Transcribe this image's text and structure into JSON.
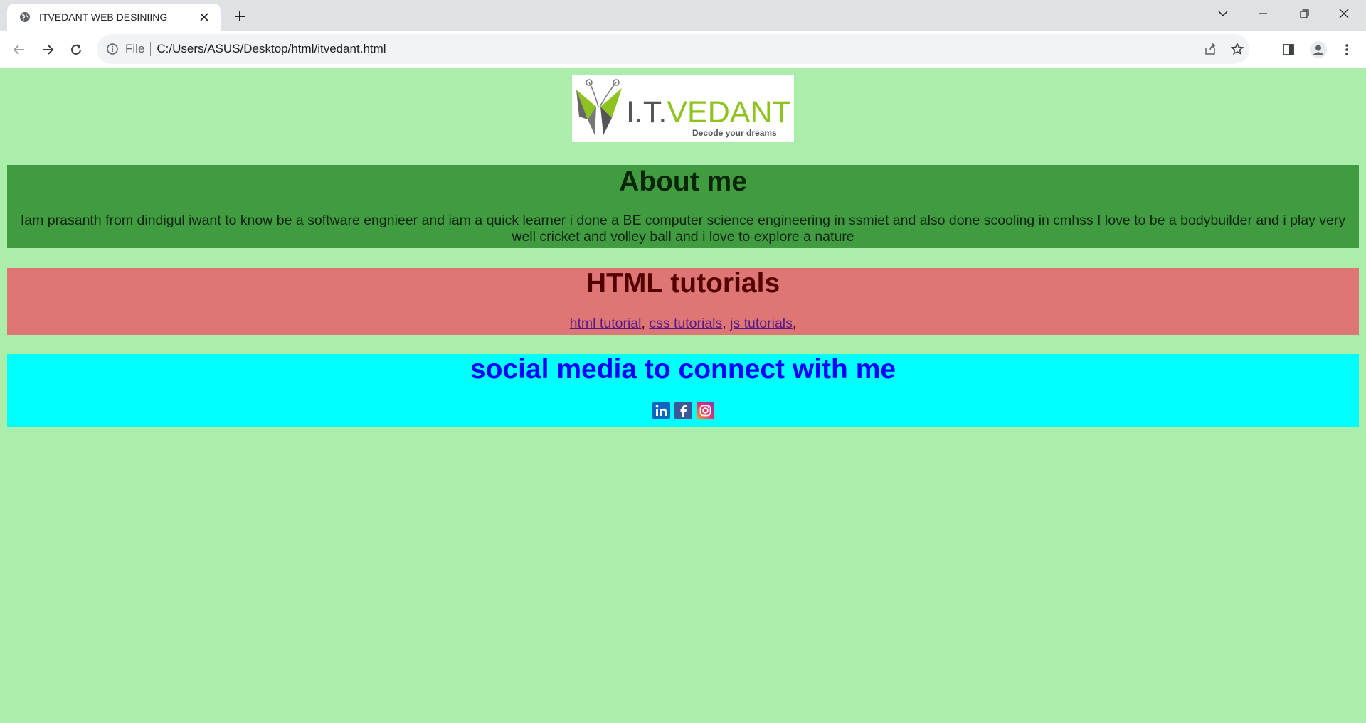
{
  "browser": {
    "tab_title": "ITVEDANT WEB DESINIING",
    "url_scheme": "File",
    "url": "C:/Users/ASUS/Desktop/html/itvedant.html"
  },
  "logo": {
    "brand_it": "I.T.",
    "brand_vedant": "VEDANT",
    "tagline": "Decode your dreams"
  },
  "about": {
    "heading": "About me",
    "text": "Iam prasanth from dindigul iwant to know be a software engnieer and iam a quick learner i done a BE computer science engineering in ssmiet and also done scooling in cmhss I love to be a bodybuilder and i play very well cricket and volley ball and i love to explore a nature"
  },
  "tutorials": {
    "heading": "HTML tutorials",
    "links": [
      "html tutorial",
      "css tutorials",
      "js tutorials"
    ],
    "separator": ","
  },
  "social": {
    "heading": "social media to connect with me",
    "icons": [
      "linkedin-icon",
      "facebook-icon",
      "instagram-icon"
    ]
  },
  "colors": {
    "page_bg": "#abedab",
    "about_bg": "#419c41",
    "tutorials_bg": "#df7676",
    "social_bg": "#00ffff",
    "social_heading": "#0000ff"
  }
}
